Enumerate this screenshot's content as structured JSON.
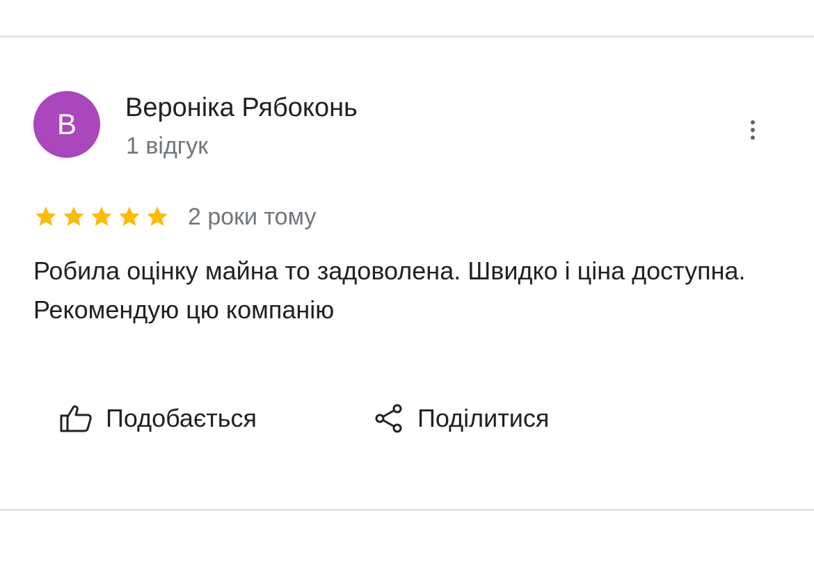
{
  "review": {
    "author": {
      "name": "Вероніка Рябоконь",
      "initial": "В",
      "meta": "1 відгук",
      "avatar_color": "#ab47bc"
    },
    "more_menu_icon": "more-vert-icon",
    "rating": {
      "value": 5,
      "max": 5,
      "star_color": "#fbbc04",
      "icon": "star-icon"
    },
    "time_ago": "2 роки тому",
    "text": "Робила оцінку майна то задоволена. Швидко і ціна доступна. Рекомендую цю компанію",
    "actions": {
      "like": {
        "label": "Подобається",
        "icon": "thumb-up-icon"
      },
      "share": {
        "label": "Поділитися",
        "icon": "share-icon"
      }
    }
  }
}
